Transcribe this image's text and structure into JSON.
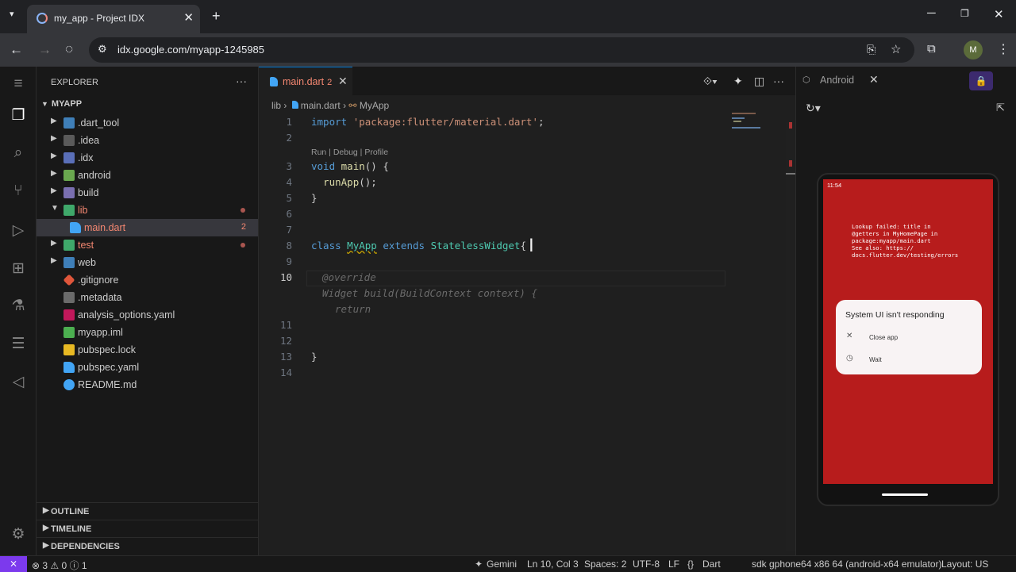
{
  "browser": {
    "tab_title": "my_app - Project IDX",
    "url": "idx.google.com/myapp-1245985",
    "avatar_letter": "M"
  },
  "explorer": {
    "header": "EXPLORER",
    "root": "MYAPP",
    "items": [
      {
        "name": ".dart_tool"
      },
      {
        "name": ".idea"
      },
      {
        "name": ".idx"
      },
      {
        "name": "android"
      },
      {
        "name": "build"
      },
      {
        "name": "lib"
      },
      {
        "name": "main.dart",
        "badge": "2"
      },
      {
        "name": "test"
      },
      {
        "name": "web"
      },
      {
        "name": ".gitignore"
      },
      {
        "name": ".metadata"
      },
      {
        "name": "analysis_options.yaml"
      },
      {
        "name": "myapp.iml"
      },
      {
        "name": "pubspec.lock"
      },
      {
        "name": "pubspec.yaml"
      },
      {
        "name": "README.md"
      }
    ],
    "sections": [
      "OUTLINE",
      "TIMELINE",
      "DEPENDENCIES"
    ]
  },
  "editor": {
    "tab_name": "main.dart",
    "tab_badge": "2",
    "breadcrumb": [
      "lib",
      "main.dart",
      "MyApp"
    ],
    "code_lens": "Run | Debug | Profile",
    "line_numbers": [
      "1",
      "2",
      "3",
      "4",
      "5",
      "6",
      "7",
      "8",
      "9",
      "10",
      "11",
      "12",
      "13",
      "14"
    ],
    "code": {
      "l1_kw": "import",
      "l1_str": "'package:flutter/material.dart'",
      "l1_end": ";",
      "l3_kw": "void",
      "l3_fn": "main",
      "l3_end": "() {",
      "l4_fn": "runApp",
      "l4_end": "();",
      "l5": "}",
      "l8_kw1": "class",
      "l8_cls1": "MyApp",
      "l8_kw2": "extends",
      "l8_cls2": "StatelessWidget",
      "l8_end": "{",
      "ghost1": "@override",
      "ghost2": "Widget build(BuildContext context) {",
      "ghost3": "return",
      "l13": "}"
    }
  },
  "android": {
    "tab_label": "Android",
    "status_time": "11:54",
    "error_text": "Lookup failed: title in\n@getters in MyHomePage in\npackage:myapp/main.dart\nSee also: https://\ndocs.flutter.dev/testing/errors",
    "dialog_title": "System UI isn't responding",
    "dialog_options": [
      "Close app",
      "Wait"
    ]
  },
  "statusbar": {
    "problems": "⊗ 3 ⚠ 0 ⓘ 1",
    "gemini": "Gemini",
    "position": "Ln 10, Col 3",
    "spaces": "Spaces: 2",
    "encoding": "UTF-8",
    "eol": "LF",
    "language": "Dart",
    "device": "sdk gphone64 x86 64 (android-x64 emulator)",
    "layout": "Layout: US"
  },
  "colors": {
    "accent": "#0078d4",
    "error": "#f48771",
    "phone_screen": "#b71c1c",
    "remote": "#7c3aed"
  }
}
